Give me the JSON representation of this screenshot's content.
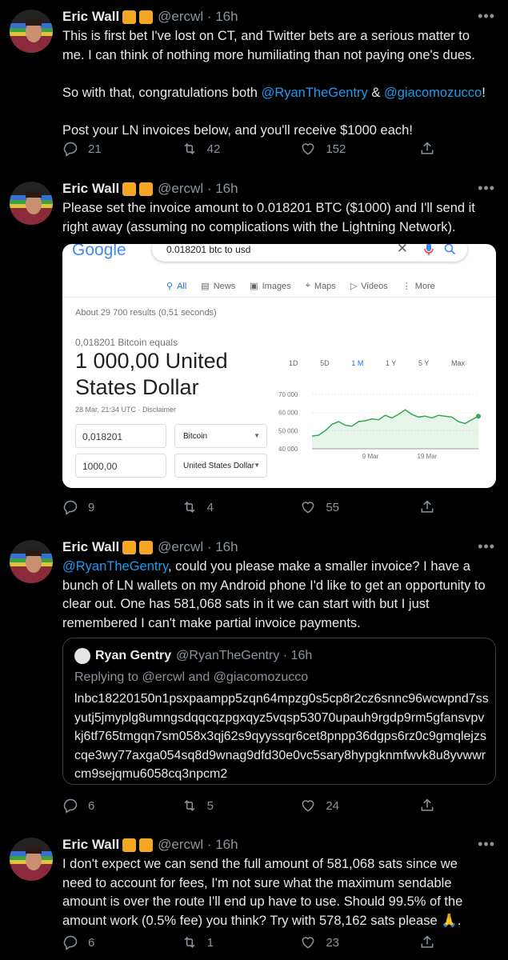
{
  "author": {
    "name": "Eric Wall",
    "handle": "@ercwl",
    "time": "16h",
    "more": "•••"
  },
  "tweets": [
    {
      "body_parts": [
        "This is first bet I've lost on CT, and Twitter bets are a serious matter to me. I can think of nothing more humiliating than not paying one's dues.\n\nSo with that, congratulations both ",
        "@RyanTheGentry",
        " & ",
        "@giacomozucco",
        "!\n\nPost your LN invoices below, and you'll receive $1000 each!"
      ],
      "replies": "21",
      "retweets": "42",
      "likes": "152"
    },
    {
      "body": "Please set the invoice amount to 0.018201 BTC ($1000) and I'll send it right away (assuming no complications with the Lightning Network).",
      "replies": "9",
      "retweets": "4",
      "likes": "55"
    },
    {
      "mention": "@RyanTheGentry",
      "body_rest": ", could you please make a smaller invoice? I have a bunch of LN wallets on my Android phone I'd like to get an opportunity to clear out. One has 581,068 sats in it we can start with but I just remembered I can't make partial invoice payments.",
      "replies": "6",
      "retweets": "5",
      "likes": "24"
    },
    {
      "body": "I don't expect we can send the full amount of 581,068 sats since we need to account for fees, I'm not sure what the maximum sendable amount is over the route I'll end up have to use. Should 99.5% of the amount work (0.5% fee) you think? Try with 578,162 sats please 🙏.",
      "replies": "6",
      "retweets": "1",
      "likes": "23"
    }
  ],
  "quote": {
    "name": "Ryan Gentry",
    "handle": "@RyanTheGentry",
    "time": "16h",
    "replying_prefix": "Replying to ",
    "replying_1": "@ercwl",
    "replying_and": " and ",
    "replying_2": "@giacomozucco",
    "text": "lnbc18220150n1psxpaampp5zqn64mpzg0s5cp8r2cz6snnc96wcwpnd7ssyutj5jmyplg8umngsdqqcqzpgxqyz5vqsp53070upauh9rgdp9rm5gfansvpvkj6tf765tmgqn7sm058x3qj62s9qyyssqr6cet8pnpp36dgps6rz0c9gmqlejzscqe3wy77axga054sq8d9wnag9dfd30e0vc5sary8hypgknmfwvk8u8yvwwrcm9sejqmu6058cq3npcm2"
  },
  "google": {
    "logo": "Google",
    "query": "0.018201 btc to usd",
    "tabs": [
      "All",
      "News",
      "Images",
      "Maps",
      "Videos",
      "More"
    ],
    "results": "About 29 700 results (0,51 seconds)",
    "equals": "0,018201 Bitcoin equals",
    "big_value": "1 000,00 United States Dollar",
    "timestamp": "28 Mar, 21:34 UTC · Disclaimer",
    "input_value": "0,018201",
    "input_unit": "Bitcoin",
    "output_value": "1000,00",
    "output_unit": "United States Dollar",
    "ranges": [
      "1D",
      "5D",
      "1 M",
      "1 Y",
      "5 Y",
      "Max"
    ],
    "active_range": "1 M",
    "line_color": "#34a853",
    "link_color": "#1a73e8"
  },
  "chart_data": {
    "type": "line",
    "x_ticks": [
      "9 Mar",
      "19 Mar"
    ],
    "y_ticks": [
      "70 000",
      "60 000",
      "50 000",
      "40 000"
    ],
    "ylim": [
      40000,
      70000
    ],
    "values": [
      47000,
      47500,
      50000,
      53500,
      55000,
      53000,
      52500,
      55000,
      55500,
      56500,
      56000,
      58500,
      57000,
      59000,
      61500,
      59000,
      57500,
      58000,
      57000,
      58500,
      58000,
      57500,
      55000,
      54000,
      56000,
      58000
    ],
    "color": "#34a853"
  },
  "colors": {
    "link": "#1d9bf0",
    "muted": "#8b949e",
    "badge": "#f5a623"
  }
}
